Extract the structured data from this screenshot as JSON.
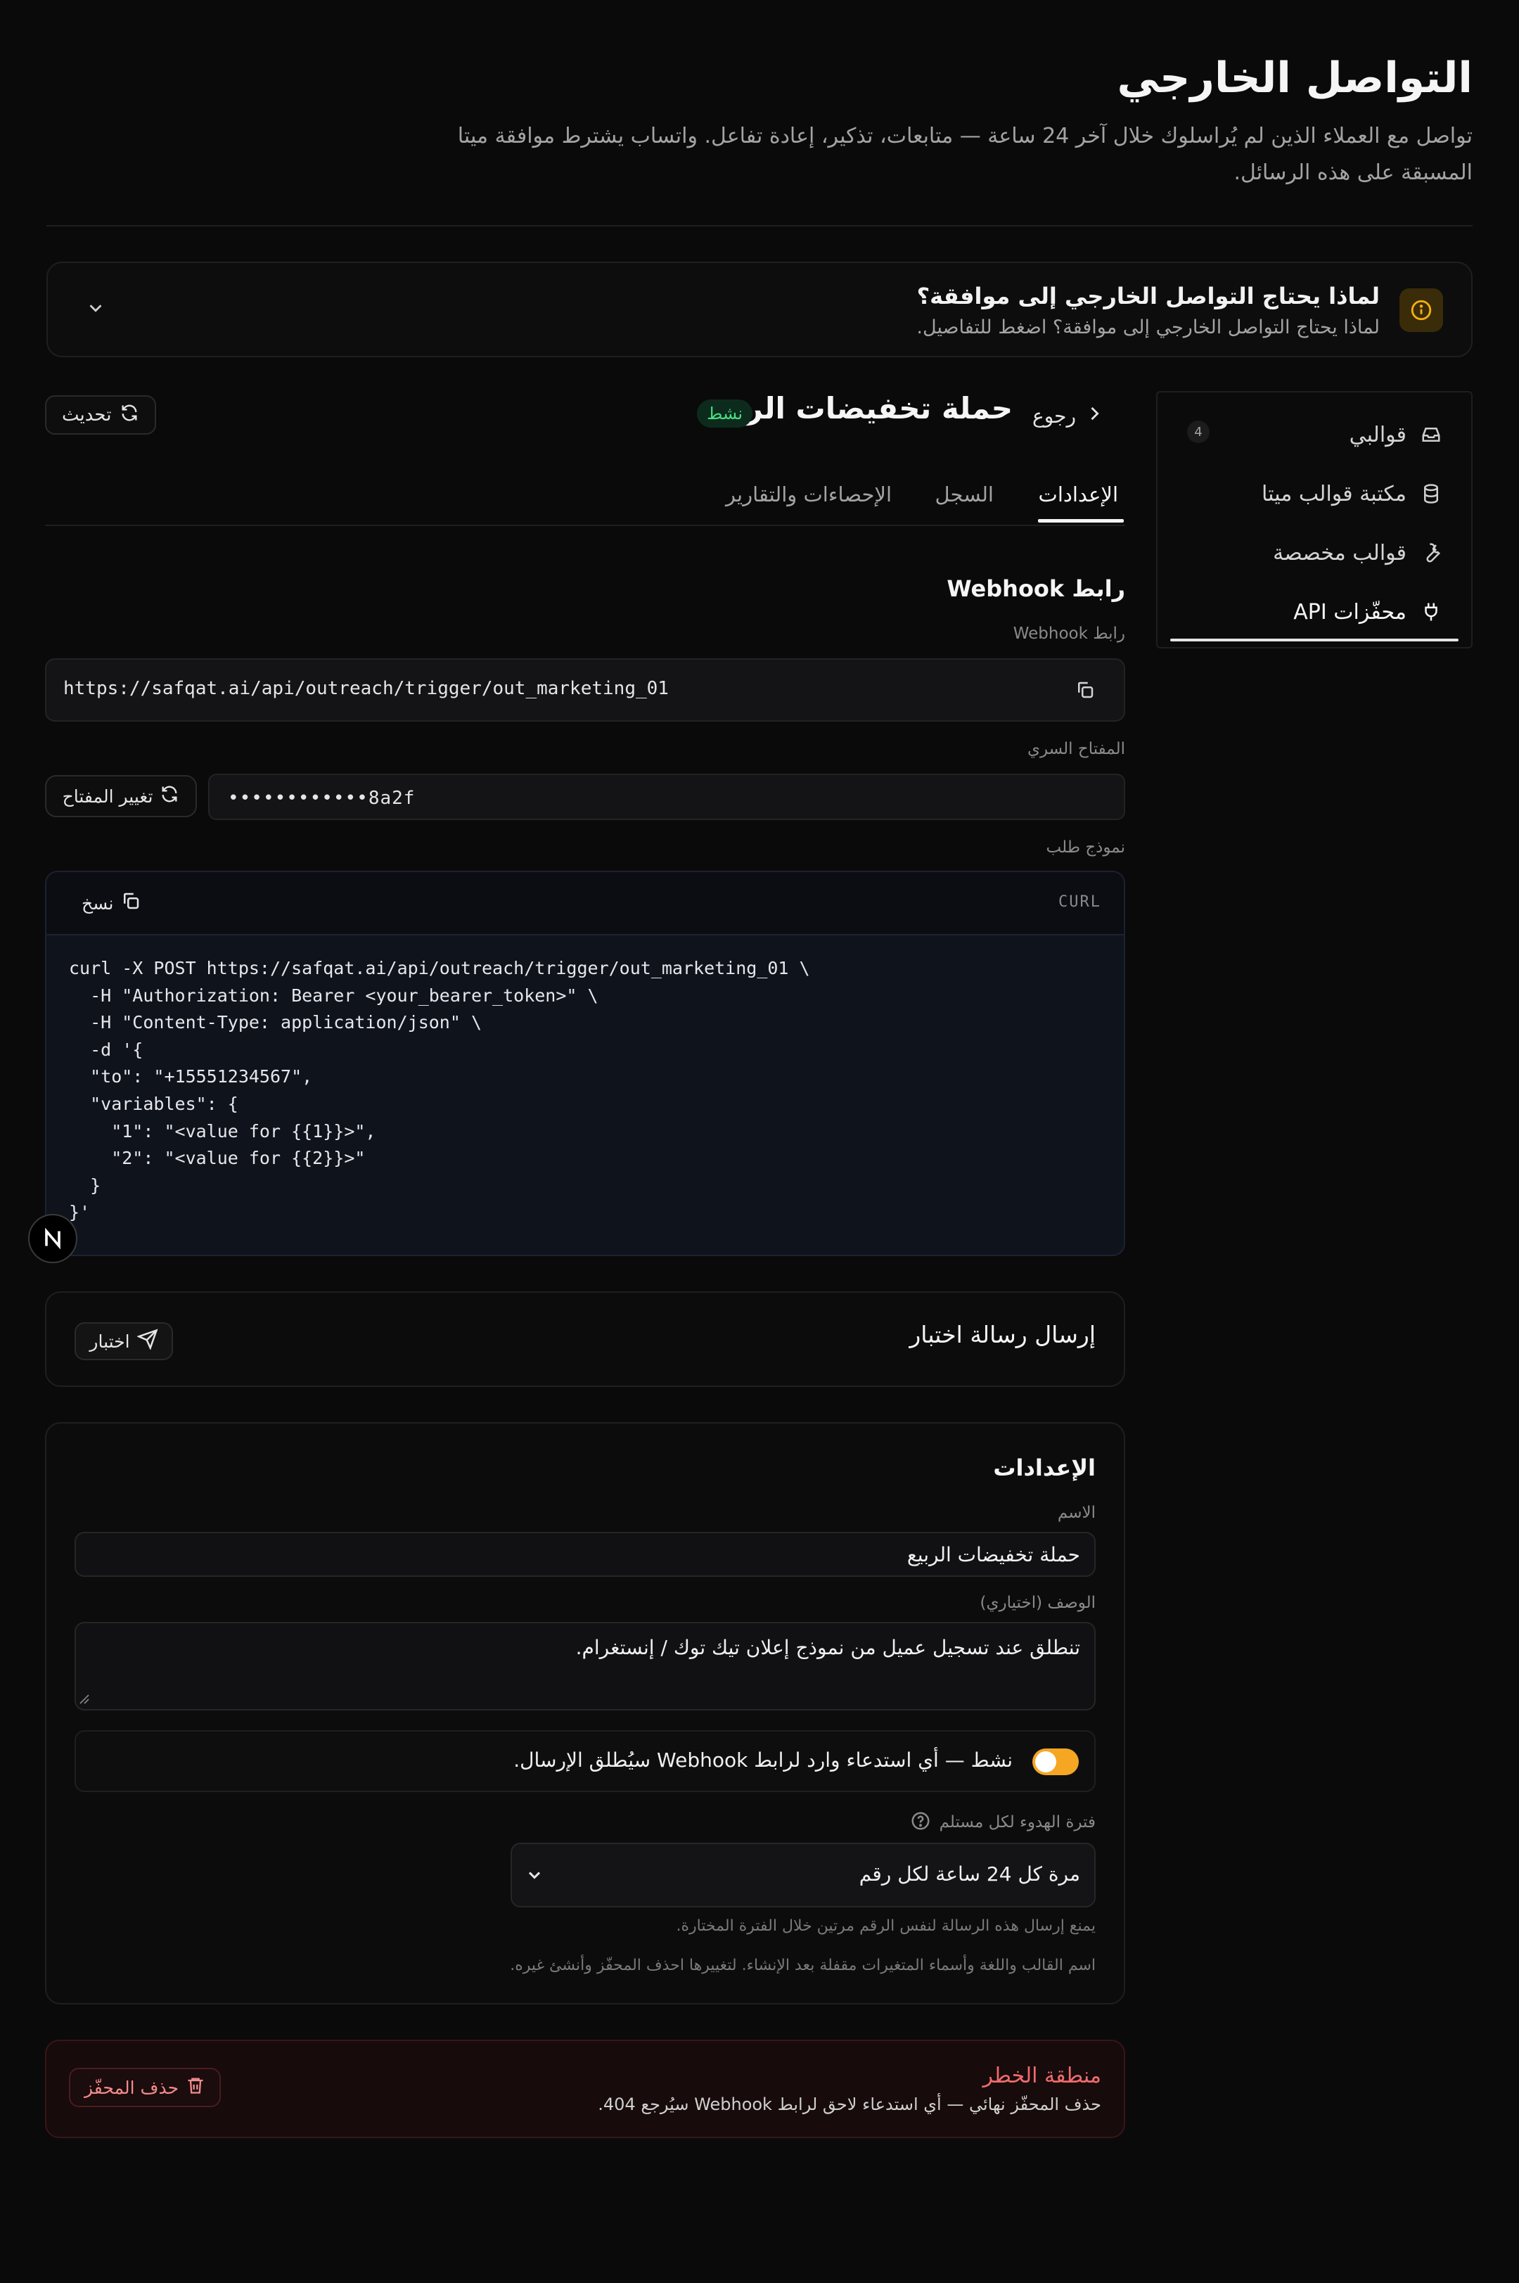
{
  "header": {
    "title": "التواصل الخارجي",
    "description": "تواصل مع العملاء الذين لم يُراسلوك خلال آخر 24 ساعة — متابعات، تذكير، إعادة تفاعل. واتساب يشترط موافقة ميتا المسبقة على هذه الرسائل."
  },
  "info": {
    "title": "لماذا يحتاج التواصل الخارجي إلى موافقة؟",
    "subtitle": "لماذا يحتاج التواصل الخارجي إلى موافقة؟ اضغط للتفاصيل."
  },
  "sidebar": {
    "items": [
      {
        "label": "قوالبي",
        "icon": "inbox-icon",
        "badge": "4"
      },
      {
        "label": "مكتبة قوالب ميتا",
        "icon": "database-icon"
      },
      {
        "label": "قوالب مخصصة",
        "icon": "wrench-icon"
      },
      {
        "label": "محفّزات API",
        "icon": "plug-icon",
        "active": true
      }
    ]
  },
  "main": {
    "back_label": "رجوع",
    "title": "حملة تخفيضات الربيع",
    "status": "نشط",
    "refresh_label": "تحديث",
    "tabs": [
      {
        "label": "الإعدادات",
        "active": true
      },
      {
        "label": "السجل"
      },
      {
        "label": "الإحصاءات والتقارير"
      }
    ]
  },
  "webhook": {
    "section_title": "رابط Webhook",
    "url_label": "رابط Webhook",
    "url": "https://safqat.ai/api/outreach/trigger/out_marketing_01",
    "secret_label": "المفتاح السري",
    "secret_masked": "••••••••••••8a2f",
    "rotate_label": "تغيير المفتاح",
    "sample_label": "نموذج طلب",
    "code_lang": "CURL",
    "copy_label": "نسخ",
    "code": "curl -X POST https://safqat.ai/api/outreach/trigger/out_marketing_01 \\\n  -H \"Authorization: Bearer <your_bearer_token>\" \\\n  -H \"Content-Type: application/json\" \\\n  -d '{\n  \"to\": \"+15551234567\",\n  \"variables\": {\n    \"1\": \"<value for {{1}}>\",\n    \"2\": \"<value for {{2}}>\"\n  }\n}'"
  },
  "test": {
    "title": "إرسال رسالة اختبار",
    "button": "اختبار"
  },
  "settings": {
    "title": "الإعدادات",
    "name_label": "الاسم",
    "name_value": "حملة تخفيضات الربيع",
    "desc_label": "الوصف (اختياري)",
    "desc_value": "تنطلق عند تسجيل عميل من نموذج إعلان تيك توك / إنستغرام.",
    "active_label": "نشط — أي استدعاء وارد لرابط Webhook سيُطلق الإرسال.",
    "active": true,
    "cooldown_label": "فترة الهدوء لكل مستلم",
    "cooldown_value": "مرة كل 24 ساعة لكل رقم",
    "cooldown_hint": "يمنع إرسال هذه الرسالة لنفس الرقم مرتين خلال الفترة المختارة.",
    "lock_hint": "اسم القالب واللغة وأسماء المتغيرات مقفلة بعد الإنشاء. لتغييرها احذف المحفّز وأنشئ غيره."
  },
  "danger": {
    "title": "منطقة الخطر",
    "subtitle": "حذف المحفّز نهائي — أي استدعاء لاحق لرابط Webhook سيُرجع 404.",
    "button": "حذف المحفّز"
  },
  "colors": {
    "accent_toggle": "#f5a623",
    "status_green": "#4ade80",
    "danger_red": "#ef6b6b"
  }
}
